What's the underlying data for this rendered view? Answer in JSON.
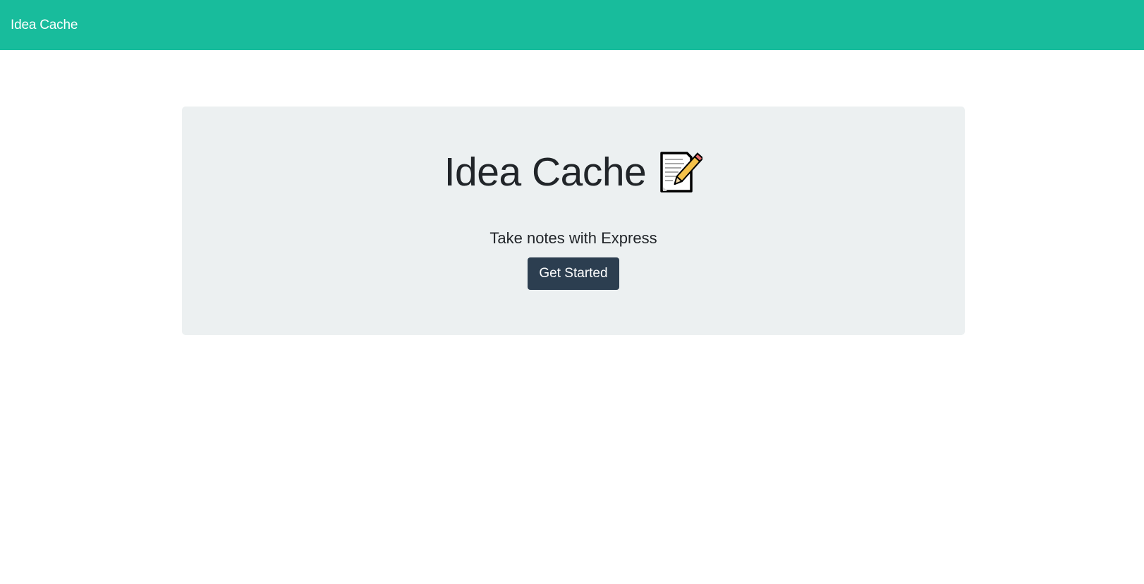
{
  "navbar": {
    "brand": "Idea Cache"
  },
  "jumbotron": {
    "title": "Idea Cache",
    "title_icon": "memo-icon",
    "lead": "Take notes with Express",
    "cta_label": "Get Started"
  },
  "colors": {
    "navbar_bg": "#18bc9c",
    "jumbotron_bg": "#ecf0f1",
    "button_bg": "#2c3e50",
    "text_dark": "#212529",
    "text_light": "#ffffff"
  }
}
